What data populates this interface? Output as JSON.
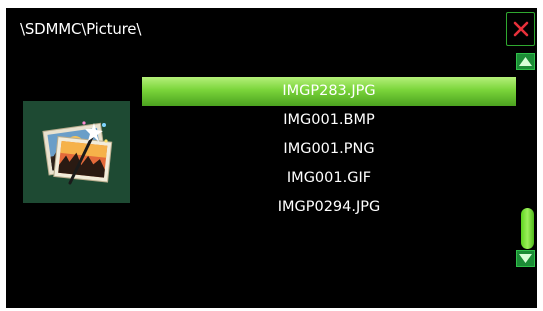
{
  "header": {
    "path": "\\SDMMC\\Picture\\"
  },
  "colors": {
    "selection": "#7ad43a",
    "close_x": "#e8303a",
    "accent_green": "#2fa82f"
  },
  "files": [
    {
      "name": "IMGP283.JPG",
      "selected": true
    },
    {
      "name": "IMG001.BMP",
      "selected": false
    },
    {
      "name": "IMG001.PNG",
      "selected": false
    },
    {
      "name": "IMG001.GIF",
      "selected": false
    },
    {
      "name": "IMGP0294.JPG",
      "selected": false
    }
  ],
  "icons": {
    "close": "close-icon",
    "thumbnail": "picture-folder-icon",
    "up": "arrow-up-icon",
    "down": "arrow-down-icon"
  }
}
